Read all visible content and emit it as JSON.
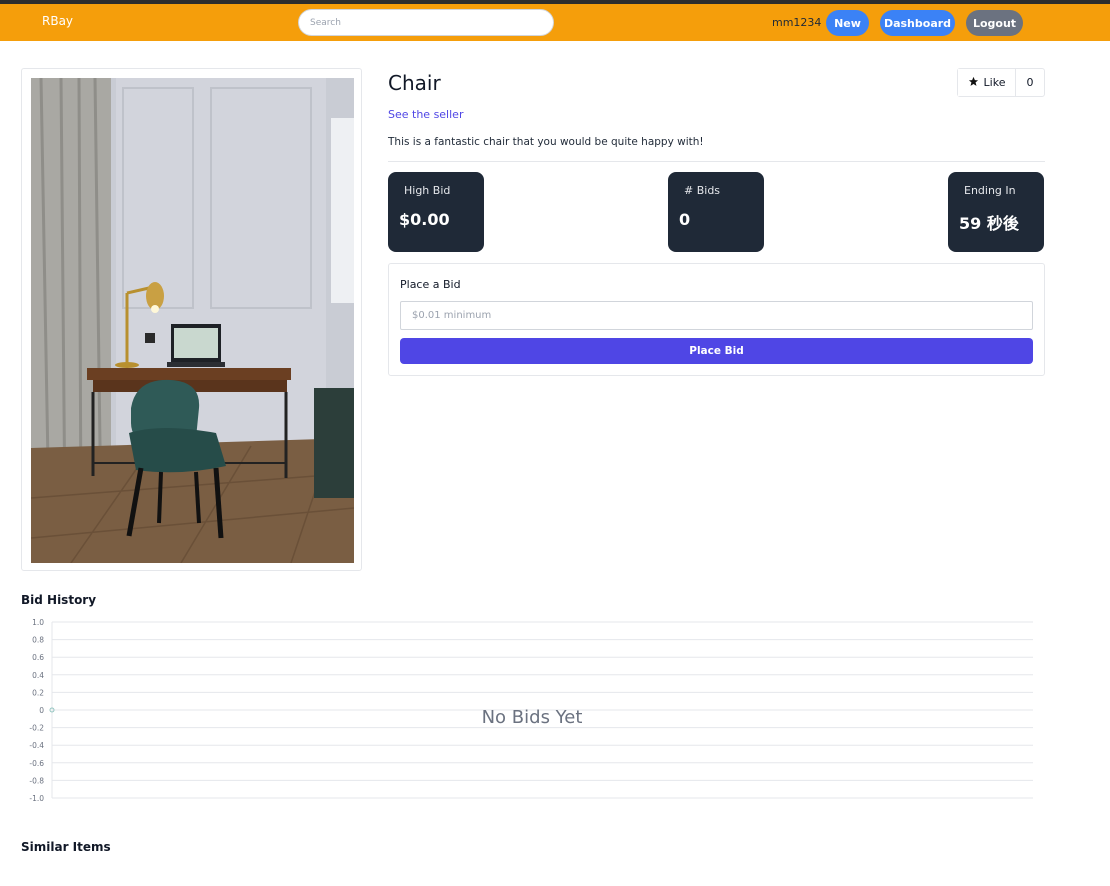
{
  "nav": {
    "brand": "RBay",
    "search_placeholder": "Search",
    "username": "mm1234",
    "new_label": "New",
    "dashboard_label": "Dashboard",
    "logout_label": "Logout"
  },
  "item": {
    "title": "Chair",
    "seller_link": "See the seller",
    "description": "This is a fantastic chair that you would be quite happy with!",
    "like_label": "Like",
    "like_count": "0"
  },
  "stats": [
    {
      "label": "High Bid",
      "value": "$0.00"
    },
    {
      "label": "# Bids",
      "value": "0"
    },
    {
      "label": "Ending In",
      "value": "59 秒後"
    }
  ],
  "bid": {
    "heading": "Place a Bid",
    "placeholder": "$0.01 minimum",
    "button_label": "Place Bid"
  },
  "sections": {
    "bid_history": "Bid History",
    "similar_items": "Similar Items"
  },
  "chart_data": {
    "type": "line",
    "title": "",
    "xlabel": "",
    "ylabel": "",
    "y_ticks": [
      "1.0",
      "0.8",
      "0.6",
      "0.4",
      "0.2",
      "0",
      "-0.2",
      "-0.4",
      "-0.6",
      "-0.8",
      "-1.0"
    ],
    "ylim": [
      -1.0,
      1.0
    ],
    "series": [
      {
        "values": [
          0
        ]
      }
    ],
    "grid": true,
    "empty_message": "No Bids Yet"
  }
}
